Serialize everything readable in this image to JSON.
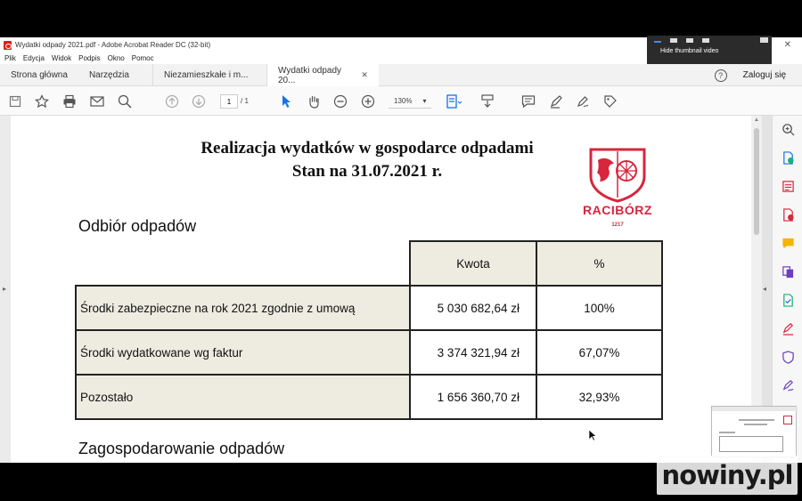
{
  "window": {
    "title": "Wydatki odpady 2021.pdf - Adobe Acrobat Reader DC (32-bit)",
    "controls": {
      "minimize": "—",
      "close": "✕"
    }
  },
  "tooltip": {
    "text": "Hide thumbnail video"
  },
  "menu": {
    "items": [
      "Plik",
      "Edycja",
      "Widok",
      "Podpis",
      "Okno",
      "Pomoc"
    ]
  },
  "tabs": {
    "home": "Strona główna",
    "tools": "Narzędzia",
    "doc1": "Niezamieszkałe i m...",
    "doc2": "Wydatki odpady 20...",
    "close": "✕",
    "help": "?",
    "login": "Zaloguj się"
  },
  "toolbar": {
    "page_current": "1",
    "page_total": "/ 1",
    "zoom": "130%",
    "zoom_arrow": "▾"
  },
  "document": {
    "title_line1": "Realizacja wydatków w gospodarce odpadami",
    "title_line2": "Stan na  31.07.2021 r.",
    "logo_text": "RACIBÓRZ",
    "logo_year": "1217",
    "section1": "Odbiór odpadów",
    "section2": "Zagospodarowanie odpadów",
    "table": {
      "headers": [
        "Kwota",
        "%"
      ],
      "rows": [
        {
          "label": "Środki zabezpieczne na rok 2021 zgodnie z umową",
          "amount": "5 030 682,64 zł",
          "percent": "100%"
        },
        {
          "label": "Środki wydatkowane wg faktur",
          "amount": "3 374 321,94 zł",
          "percent": "67,07%"
        },
        {
          "label": "Pozostało",
          "amount": "1 656 360,70 zł",
          "percent": "32,93%"
        }
      ]
    }
  },
  "watermark": "nowiny.pl",
  "colors": {
    "accent_red": "#d7263d",
    "table_fill": "#eeece1",
    "acrobat_blue": "#1473e6"
  }
}
